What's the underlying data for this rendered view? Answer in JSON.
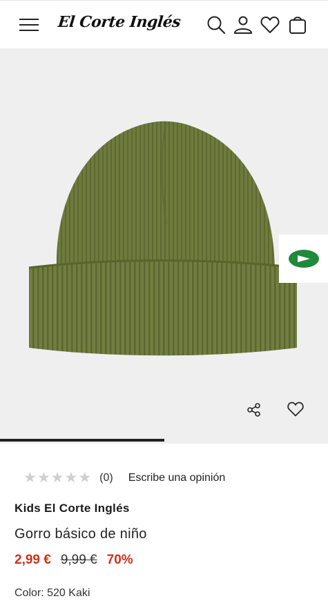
{
  "header": {
    "logo_text": "El Corte Inglés",
    "icons": [
      "menu-icon",
      "search-icon",
      "user-icon",
      "heart-icon",
      "bag-icon"
    ]
  },
  "gallery": {
    "image_alt": "Gorro básico de niño",
    "progress_fraction": 0.5,
    "badge_icon": "play-arrow-icon",
    "action_icons": [
      "share-icon",
      "heart-icon"
    ]
  },
  "colors": {
    "accent": "#c8341b",
    "hat": "#6f7a3d",
    "badge_green": "#1e8a3a"
  },
  "product": {
    "rating": {
      "stars": 5,
      "filled": 0,
      "count": "(0)",
      "write_review": "Escribe una opinión"
    },
    "brand": "Kids El Corte Inglés",
    "title": "Gorro básico de niño",
    "price_now": "2,99 €",
    "price_old": "9,99 €",
    "discount": "70%",
    "color": "Color: 520 Kaki"
  }
}
